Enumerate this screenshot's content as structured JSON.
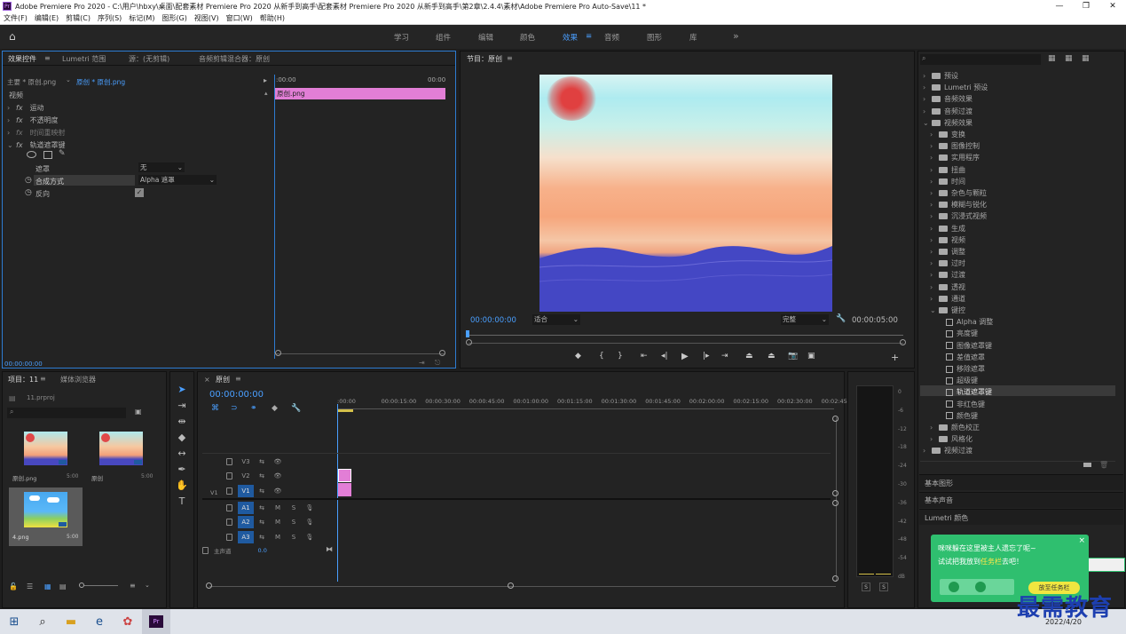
{
  "titlebar": {
    "title": "Adobe Premiere Pro 2020 - C:\\用户\\hbxy\\桌面\\配套素材 Premiere Pro 2020 从新手到高手\\配套素材 Premiere Pro 2020 从新手到高手\\第2章\\2.4.4\\素材\\Adobe Premiere Pro Auto-Save\\11 *",
    "app_icon": "Pr",
    "min": "—",
    "max": "❐",
    "close": "✕"
  },
  "menubar": [
    "文件(F)",
    "编辑(E)",
    "剪辑(C)",
    "序列(S)",
    "标记(M)",
    "图形(G)",
    "视图(V)",
    "窗口(W)",
    "帮助(H)"
  ],
  "workspaces": [
    "学习",
    "组件",
    "编辑",
    "颜色",
    "效果",
    "音频",
    "图形",
    "库"
  ],
  "active_workspace": "效果",
  "workspace_more": "»",
  "effect_controls": {
    "tabs": [
      "效果控件",
      "Lumetri 范围",
      "源：(无剪辑)",
      "音频剪辑混合器：原创"
    ],
    "master": "主要 * 原创.png",
    "clip": "原创 * 原创.png",
    "t0": ":00:00",
    "t1": "00:00",
    "section": "视频",
    "clip_bar": "原创.png",
    "effects": [
      "运动",
      "不透明度",
      "时间重映射",
      "轨道遮罩键"
    ],
    "mask_label": "遮罩",
    "mask_value": "无",
    "composite_label": "合成方式",
    "composite_value": "Alpha 遮罩",
    "reverse_label": "反向",
    "timecode": "00:00:00:00"
  },
  "program": {
    "tab": "节目：原创",
    "timecode": "00:00:00:00",
    "fit": "适合",
    "quality": "完整",
    "duration": "00:00:05:00"
  },
  "project": {
    "tabs": [
      "项目：11",
      "媒体浏览器"
    ],
    "file": "11.prproj",
    "items": [
      {
        "name": "原创.png",
        "dur": "5:00"
      },
      {
        "name": "原创",
        "dur": "5:00"
      },
      {
        "name": "4.png",
        "dur": "5:00"
      }
    ]
  },
  "timeline": {
    "tab": "原创",
    "timecode": "00:00:00:00",
    "ruler": [
      ":00:00",
      "00:00:15:00",
      "00:00:30:00",
      "00:00:45:00",
      "00:01:00:00",
      "00:01:15:00",
      "00:01:30:00",
      "00:01:45:00",
      "00:02:00:00",
      "00:02:15:00",
      "00:02:30:00",
      "00:02:45:"
    ],
    "video_tracks": [
      "V3",
      "V2",
      "V1"
    ],
    "audio_tracks": [
      "A1",
      "A2",
      "A3"
    ],
    "master": "主声道",
    "master_val": "0.0",
    "src_v1": "V1"
  },
  "meter": {
    "ticks": [
      "0",
      "-6",
      "-12",
      "-18",
      "-24",
      "-30",
      "-36",
      "-42",
      "-48",
      "-54",
      "dB"
    ],
    "s1": "S",
    "s2": "S"
  },
  "effects_panel": {
    "items": [
      {
        "label": "预设",
        "level": 0,
        "open": false,
        "type": "folder"
      },
      {
        "label": "Lumetri 预设",
        "level": 0,
        "open": false,
        "type": "folder"
      },
      {
        "label": "音频效果",
        "level": 0,
        "open": false,
        "type": "folder"
      },
      {
        "label": "音频过渡",
        "level": 0,
        "open": false,
        "type": "folder"
      },
      {
        "label": "视频效果",
        "level": 0,
        "open": true,
        "type": "folder"
      },
      {
        "label": "变换",
        "level": 1,
        "open": false,
        "type": "folder"
      },
      {
        "label": "图像控制",
        "level": 1,
        "open": false,
        "type": "folder"
      },
      {
        "label": "实用程序",
        "level": 1,
        "open": false,
        "type": "folder"
      },
      {
        "label": "扭曲",
        "level": 1,
        "open": false,
        "type": "folder"
      },
      {
        "label": "时间",
        "level": 1,
        "open": false,
        "type": "folder"
      },
      {
        "label": "杂色与颗粒",
        "level": 1,
        "open": false,
        "type": "folder"
      },
      {
        "label": "模糊与锐化",
        "level": 1,
        "open": false,
        "type": "folder"
      },
      {
        "label": "沉浸式视频",
        "level": 1,
        "open": false,
        "type": "folder"
      },
      {
        "label": "生成",
        "level": 1,
        "open": false,
        "type": "folder"
      },
      {
        "label": "视频",
        "level": 1,
        "open": false,
        "type": "folder"
      },
      {
        "label": "调整",
        "level": 1,
        "open": false,
        "type": "folder"
      },
      {
        "label": "过时",
        "level": 1,
        "open": false,
        "type": "folder"
      },
      {
        "label": "过渡",
        "level": 1,
        "open": false,
        "type": "folder"
      },
      {
        "label": "透视",
        "level": 1,
        "open": false,
        "type": "folder"
      },
      {
        "label": "通道",
        "level": 1,
        "open": false,
        "type": "folder"
      },
      {
        "label": "键控",
        "level": 1,
        "open": true,
        "type": "folder"
      },
      {
        "label": "Alpha 调整",
        "level": 2,
        "type": "fx"
      },
      {
        "label": "亮度键",
        "level": 2,
        "type": "fx"
      },
      {
        "label": "图像遮罩键",
        "level": 2,
        "type": "fx"
      },
      {
        "label": "差值遮罩",
        "level": 2,
        "type": "fx"
      },
      {
        "label": "移除遮罩",
        "level": 2,
        "type": "fx"
      },
      {
        "label": "超级键",
        "level": 2,
        "type": "fx"
      },
      {
        "label": "轨道遮罩键",
        "level": 2,
        "type": "fx",
        "selected": true
      },
      {
        "label": "非红色键",
        "level": 2,
        "type": "fx"
      },
      {
        "label": "颜色键",
        "level": 2,
        "type": "fx"
      },
      {
        "label": "颜色校正",
        "level": 1,
        "open": false,
        "type": "folder"
      },
      {
        "label": "风格化",
        "level": 1,
        "open": false,
        "type": "folder"
      },
      {
        "label": "视频过渡",
        "level": 0,
        "open": false,
        "type": "folder"
      }
    ],
    "sections": [
      "基本图形",
      "基本声音",
      "Lumetri 颜色"
    ]
  },
  "popup": {
    "line1": "咪咪躲在这里被主人遗忘了呢~",
    "line2a": "试试把我放到",
    "line2b": "任务栏",
    "line2c": "去吧！",
    "btn": "放至任务栏"
  },
  "taskbar": {
    "date": "2022/4/20"
  },
  "watermark": "最需教育"
}
